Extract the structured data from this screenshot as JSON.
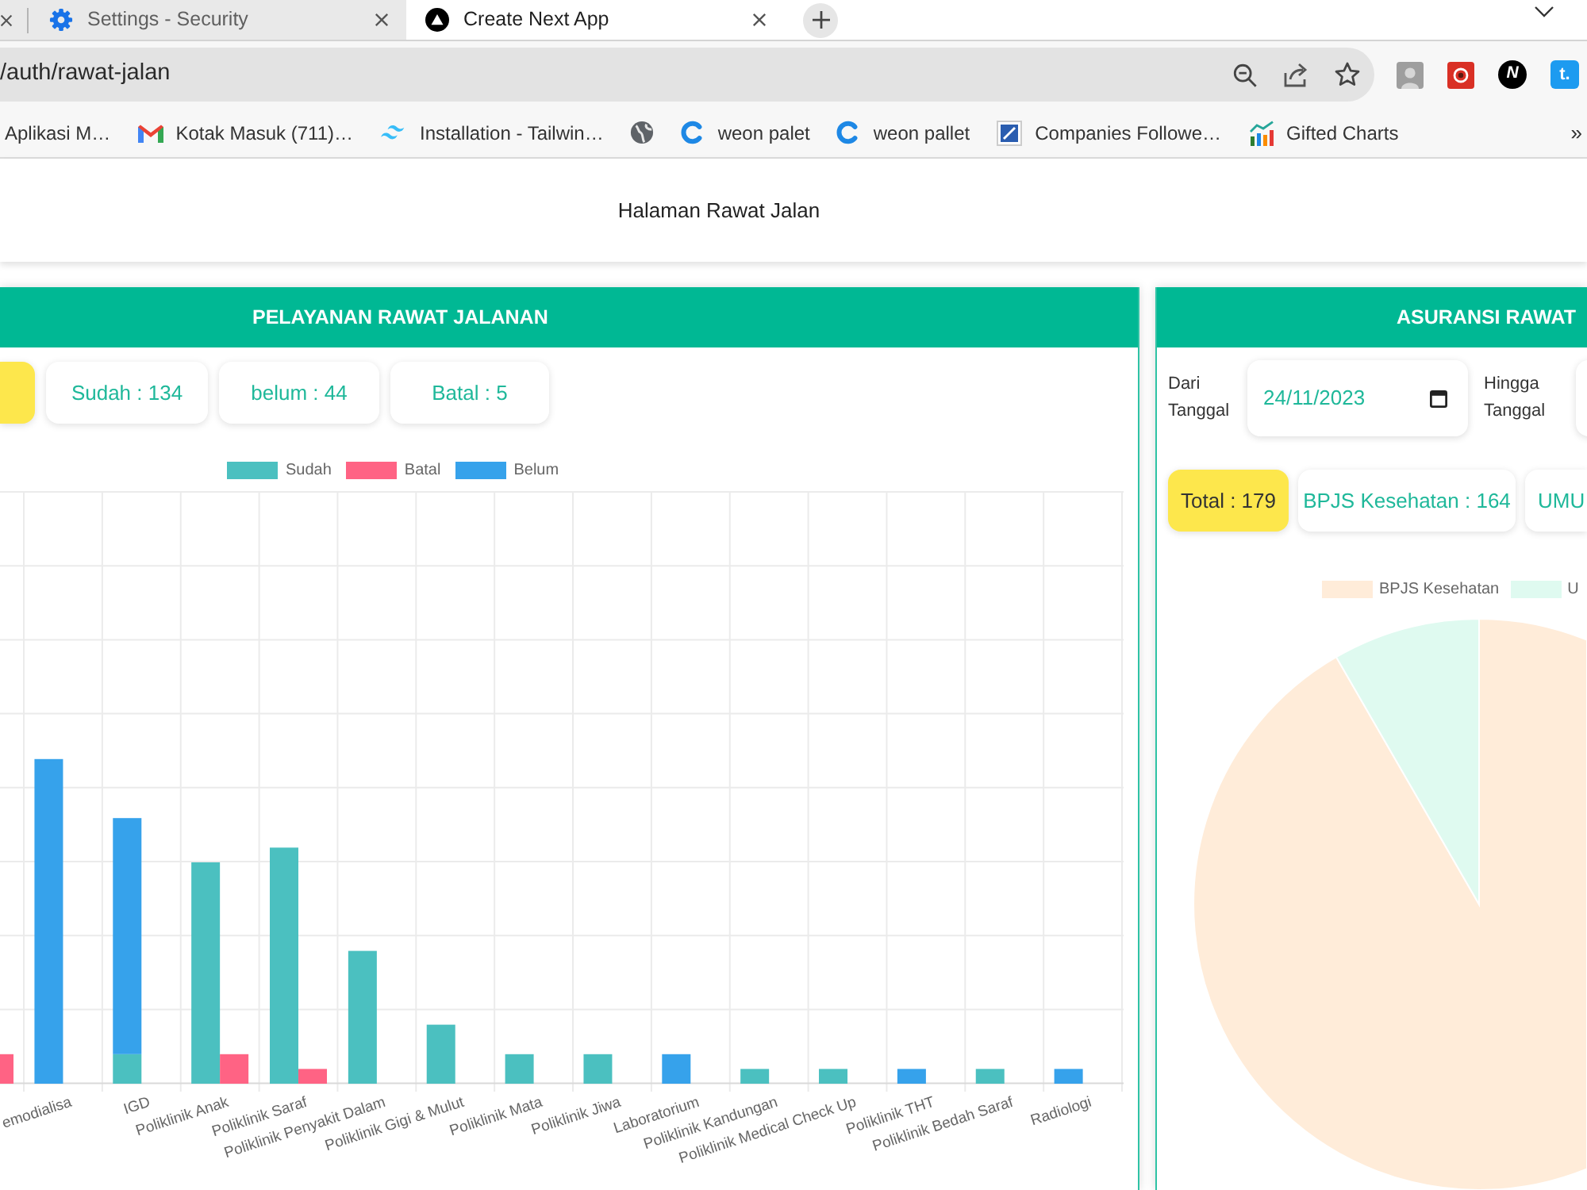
{
  "browser": {
    "tabs": [
      {
        "title": "Settings - Security",
        "selected": false
      },
      {
        "title": "Create Next App",
        "selected": true
      }
    ],
    "address": "/auth/rawat-jalan",
    "extensions": [
      {
        "kind": "photo"
      },
      {
        "kind": "app"
      },
      {
        "kind": "round",
        "glyph": "N"
      },
      {
        "kind": "tile",
        "glyph": "t."
      }
    ],
    "bookmarks": [
      {
        "kind": "link",
        "label": "Aplikasi M…"
      },
      {
        "kind": "link",
        "label": "Kotak Masuk (711)…"
      },
      {
        "kind": "link",
        "label": "Installation - Tailwin…"
      },
      {
        "kind": "icon"
      },
      {
        "kind": "link",
        "label": "weon palet"
      },
      {
        "kind": "link",
        "label": "weon pallet"
      },
      {
        "kind": "link",
        "label": "Companies Followe…"
      },
      {
        "kind": "link",
        "label": "Gifted Charts"
      }
    ],
    "more_bookmarks": "»"
  },
  "page": {
    "title": "Halaman Rawat Jalan"
  },
  "outpatient_panel": {
    "title": "PELAYANAN RAWAT JALANAN",
    "stats": [
      {
        "selected": true
      },
      {
        "label": "Sudah : 134",
        "selected": false
      },
      {
        "label": "belum : 44",
        "selected": false
      },
      {
        "label": "Batal : 5",
        "selected": false
      }
    ],
    "legend": [
      {
        "label": "Sudah",
        "color": "#4bc0c0"
      },
      {
        "label": "Batal",
        "color": "#ff6384"
      },
      {
        "label": "Belum",
        "color": "#36a2eb"
      }
    ],
    "categories": [
      "emodialisa",
      "IGD",
      "Poliklinik Anak",
      "Poliklinik Saraf",
      "Poliklinik Penyakit Dalam",
      "Poliklinik Gigi & Mulut",
      "Poliklinik Mata",
      "Poliklinik Jiwa",
      "Laboratorium",
      "Poliklinik Kandungan",
      "Poliklinik Medical Check Up",
      "Poliklinik THT",
      "Poliklinik Bedah Saraf",
      "Radiologi"
    ]
  },
  "insurance_panel": {
    "title": "ASURANSI RAWAT",
    "date_from": {
      "label": "Dari Tanggal",
      "value": "24/11/2023"
    },
    "date_to": {
      "label": "Hingga Tanggal"
    },
    "stats": [
      {
        "label": "Total : 179",
        "selected": true
      },
      {
        "label": "BPJS Kesehatan : 164",
        "selected": false
      },
      {
        "label": "UMU",
        "selected": false
      }
    ],
    "legend": [
      {
        "label": "BPJS Kesehatan",
        "color": "#ffecd9"
      },
      {
        "label": "U",
        "color": "#dffaf0"
      }
    ]
  }
}
